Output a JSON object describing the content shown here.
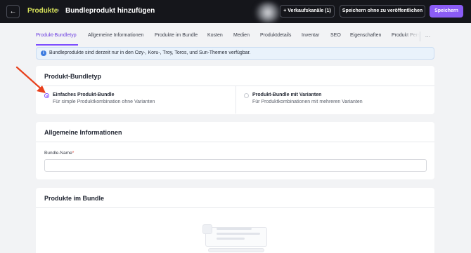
{
  "header": {
    "breadcrumb_parent": "Produkte",
    "breadcrumb_separator": "›",
    "title": "Bundleprodukt hinzufügen",
    "channels_button": "+ Verkaufskanäle (1)",
    "save_unpublished_button": "Speichern ohne zu veröffentlichen",
    "save_button": "Speichern"
  },
  "tabs": [
    {
      "label": "Produkt-Bundletyp",
      "active": true
    },
    {
      "label": "Allgemeine Informationen",
      "active": false
    },
    {
      "label": "Produkte im Bundle",
      "active": false
    },
    {
      "label": "Kosten",
      "active": false
    },
    {
      "label": "Medien",
      "active": false
    },
    {
      "label": "Produktdetails",
      "active": false
    },
    {
      "label": "Inventar",
      "active": false
    },
    {
      "label": "SEO",
      "active": false
    },
    {
      "label": "Eigenschaften",
      "active": false
    },
    {
      "label": "Produkt Pers",
      "active": false
    }
  ],
  "tabs_more": "…",
  "banner": {
    "icon": "info-icon",
    "text": "Bundleprodukte sind derzeit nur in den Ozy-, Koru-, Troy, Toros, und Sun-Themen verfügbar."
  },
  "bundle_type": {
    "title": "Produkt-Bundletyp",
    "options": [
      {
        "label": "Einfaches Produkt-Bundle",
        "description": "Für simple Produktkombination ohne Varianten",
        "selected": true
      },
      {
        "label": "Produkt-Bundle mit Varianten",
        "description": "Für Produktkombinationen mit mehreren Varianten",
        "selected": false
      }
    ]
  },
  "general_info": {
    "title": "Allgemeine Informationen",
    "bundle_name_label": "Bundle-Name",
    "required_marker": "*",
    "bundle_name_value": ""
  },
  "products_in_bundle": {
    "title": "Produkte im Bundle"
  },
  "colors": {
    "accent": "#8b5cf6",
    "topbar": "#15161b",
    "breadcrumb_accent": "#d6e15a",
    "annotation_arrow": "#e8401c"
  }
}
